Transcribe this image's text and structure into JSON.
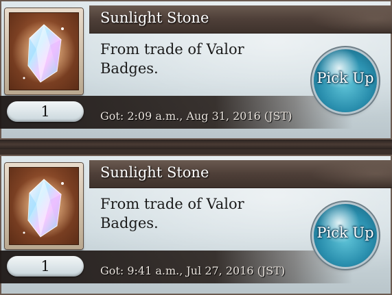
{
  "items": [
    {
      "name": "Sunlight Stone",
      "description": "From trade of Valor Badges.",
      "quantity": "1",
      "obtained": "Got: 2:09 a.m., Aug 31, 2016 (JST)",
      "button_label": "Pick Up",
      "icon": "sunlight-stone-crystal-icon"
    },
    {
      "name": "Sunlight Stone",
      "description": "From trade of Valor Badges.",
      "quantity": "1",
      "obtained": "Got: 9:41 a.m., Jul 27, 2016 (JST)",
      "button_label": "Pick Up",
      "icon": "sunlight-stone-crystal-icon"
    }
  ],
  "colors": {
    "title_bar": "#4e3f38",
    "button": "#2a8fae",
    "icon_background": "#7a3f22"
  }
}
